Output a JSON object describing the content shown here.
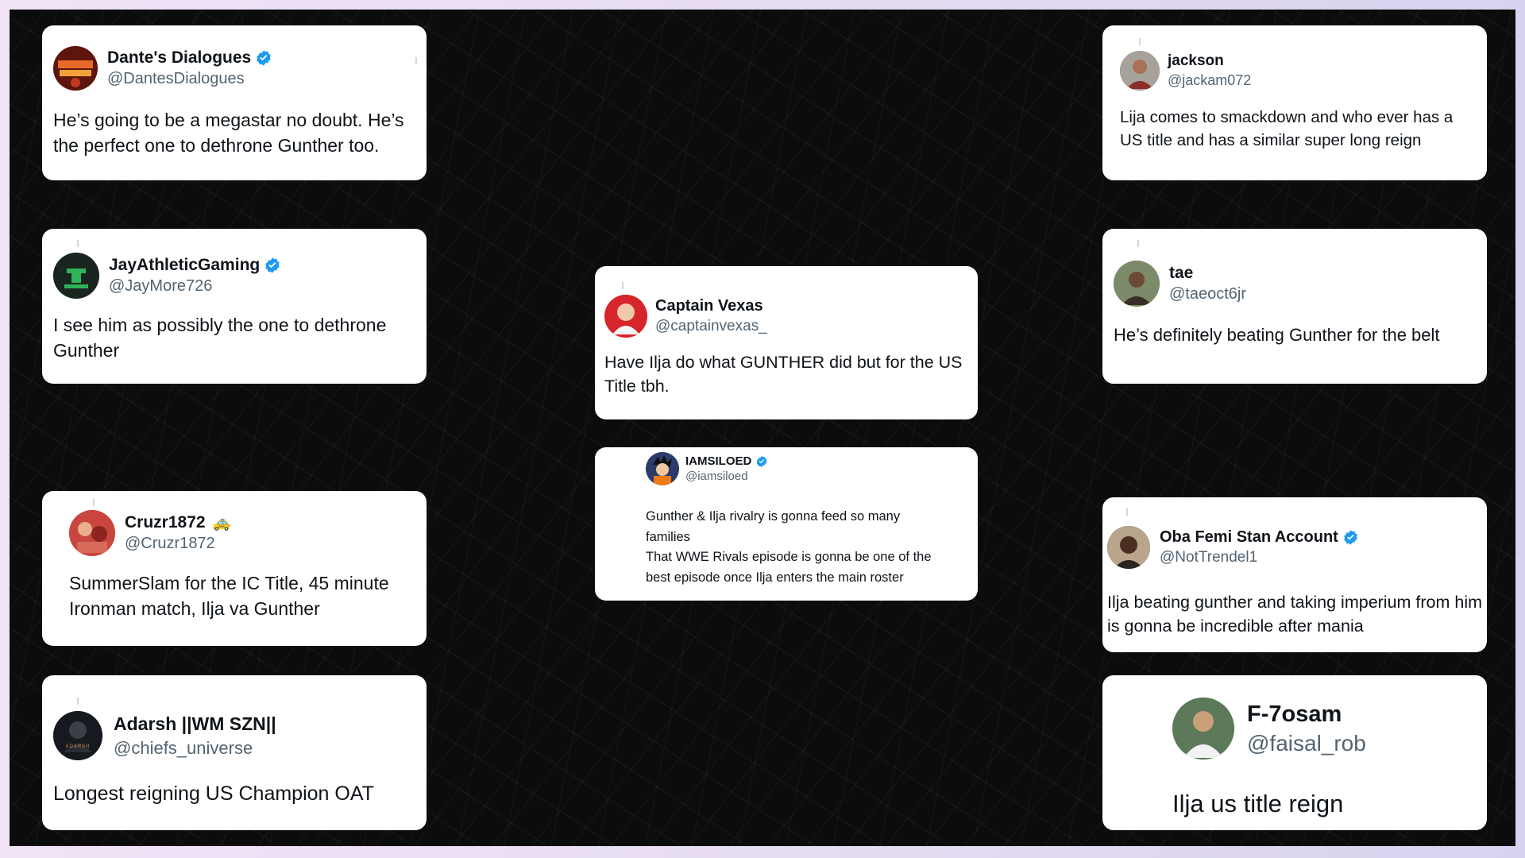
{
  "colors": {
    "background": "#0c0c0c",
    "card": "#ffffff",
    "verified": "#1d9bf0",
    "handle": "#536471"
  },
  "tweets": [
    {
      "name": "Dante's Dialogues",
      "handle": "@DantesDialogues",
      "verified": true,
      "avatar_icon": "dantes-dialogues-logo-avatar",
      "text": "He’s going to be a megastar no doubt. He’s the perfect one to dethrone Gunther too."
    },
    {
      "name": "JayAthleticGaming",
      "handle": "@JayMore726",
      "verified": true,
      "avatar_icon": "green-logo-avatar",
      "text": "I see him as possibly the one to dethrone Gunther"
    },
    {
      "name": "Cruzr1872",
      "name_emoji": "🚕",
      "handle": "@Cruzr1872",
      "verified": false,
      "avatar_icon": "person-photo-avatar",
      "text": "SummerSlam for the IC Title, 45 minute Ironman match, Ilja va Gunther"
    },
    {
      "name": "Adarsh ||WM SZN||",
      "handle": "@chiefs_universe",
      "verified": false,
      "avatar_icon": "dark-figure-avatar",
      "avatar_label": "ADARSH",
      "text": "Longest reigning US Champion OAT"
    },
    {
      "name": "Captain Vexas",
      "handle": "@captainvexas_",
      "verified": false,
      "avatar_icon": "red-character-avatar",
      "text": "Have Ilja do what GUNTHER did but for the US Title tbh."
    },
    {
      "name": "IAMSILOED",
      "handle": "@iamsiloed",
      "verified": true,
      "avatar_icon": "anime-character-avatar",
      "text": "Gunther & Ilja rivalry is gonna feed so many families\nThat WWE Rivals episode is gonna be one of the best episode once Ilja enters the main roster"
    },
    {
      "name": "jackson",
      "handle": "@jackam072",
      "verified": false,
      "avatar_icon": "person-photo-avatar",
      "text": "Lija comes to smackdown and who ever has a US title and has a similar super long reign"
    },
    {
      "name": "tae",
      "handle": "@taeoct6jr",
      "verified": false,
      "avatar_icon": "person-photo-avatar",
      "text": "He’s definitely beating Gunther for the belt"
    },
    {
      "name": "Oba Femi Stan Account",
      "handle": "@NotTrendel1",
      "verified": true,
      "avatar_icon": "person-photo-avatar",
      "text": "Ilja beating gunther and taking imperium from him is gonna be incredible after mania"
    },
    {
      "name": "F-7osam",
      "handle": "@faisal_rob",
      "verified": false,
      "avatar_icon": "person-photo-avatar",
      "text": "Ilja us title reign"
    }
  ]
}
